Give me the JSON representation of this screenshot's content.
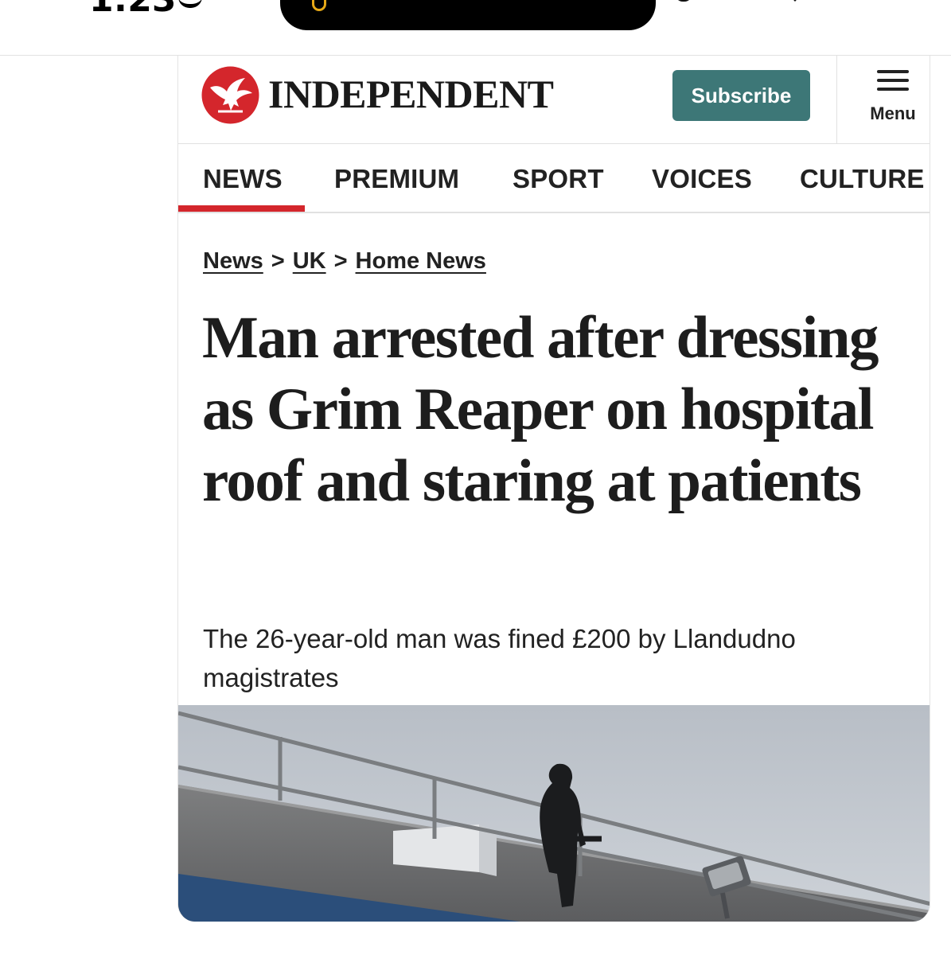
{
  "status_bar": {
    "time": "1:23"
  },
  "header": {
    "logo_text": "INDEPENDENT",
    "subscribe_label": "Subscribe",
    "menu_label": "Menu"
  },
  "nav": {
    "items": [
      {
        "label": "NEWS",
        "active": true
      },
      {
        "label": "PREMIUM",
        "active": false
      },
      {
        "label": "SPORT",
        "active": false
      },
      {
        "label": "VOICES",
        "active": false
      },
      {
        "label": "CULTURE",
        "active": false
      }
    ]
  },
  "breadcrumb": {
    "items": [
      "News",
      "UK",
      "Home News"
    ],
    "separator": ">"
  },
  "article": {
    "headline": "Man arrested after dressing as Grim Reaper on hospital roof and staring at patients",
    "standfirst": "The 26-year-old man was fined £200 by Llandudno magistrates"
  },
  "colors": {
    "brand_red": "#d4262c",
    "subscribe_teal": "#3d7777",
    "text": "#1d1d1d"
  },
  "icons": {
    "logo": "eagle-logo-icon",
    "menu": "hamburger-menu-icon"
  }
}
